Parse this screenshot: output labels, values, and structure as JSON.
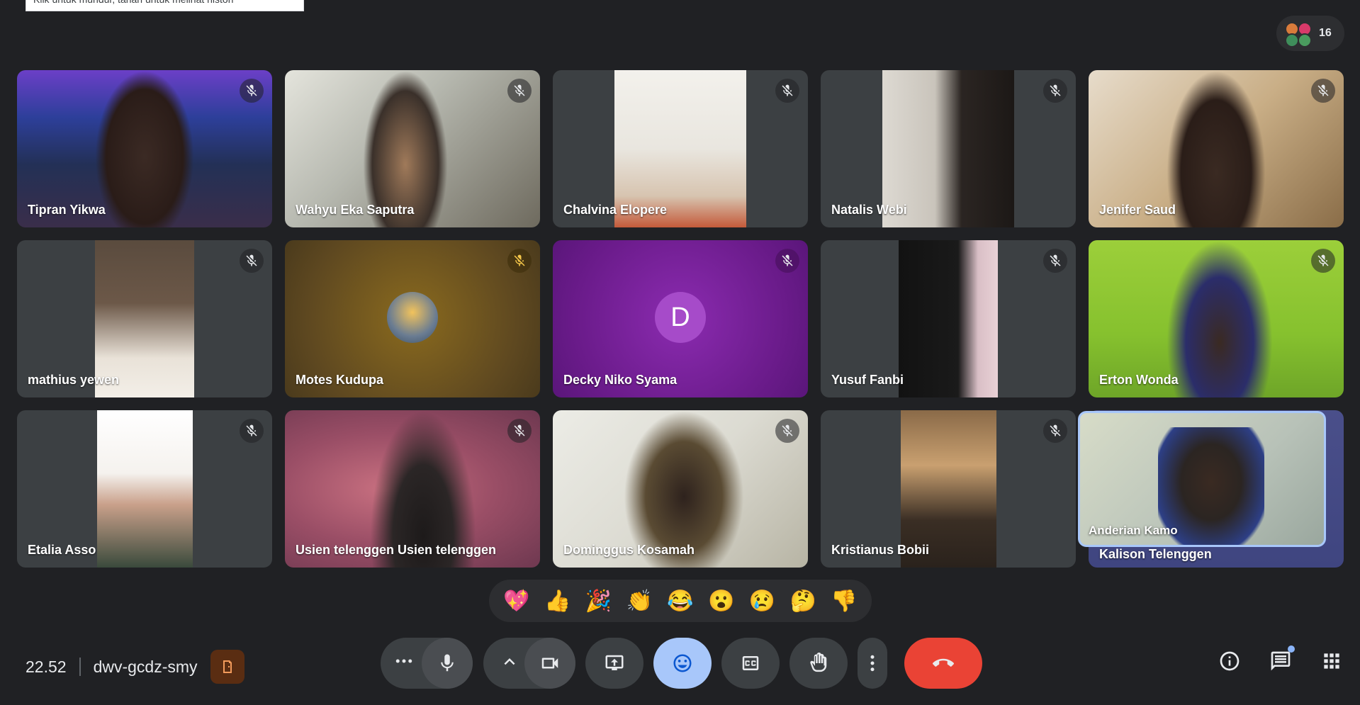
{
  "tooltip": "Klik untuk mundur, tahan untuk melihat histori",
  "people_count": "16",
  "participants": [
    {
      "name": "Tipran Yikwa"
    },
    {
      "name": "Wahyu Eka Saputra"
    },
    {
      "name": "Chalvina Elopere"
    },
    {
      "name": "Natalis Webi"
    },
    {
      "name": "Jenifer Saud"
    },
    {
      "name": "mathius yewen"
    },
    {
      "name": "Motes Kudupa"
    },
    {
      "name": "Decky Niko Syama",
      "initial": "D"
    },
    {
      "name": "Yusuf Fanbi"
    },
    {
      "name": "Erton Wonda"
    },
    {
      "name": "Etalia Asso"
    },
    {
      "name": "Usien telenggen Usien telenggen"
    },
    {
      "name": "Dominggus Kosamah"
    },
    {
      "name": "Kristianus Bobii"
    },
    {
      "name": "Kalison Telenggen"
    }
  ],
  "self_view_name": "Anderian Kamo",
  "reactions": [
    "💖",
    "👍",
    "🎉",
    "👏",
    "😂",
    "😮",
    "😢",
    "🤔",
    "👎"
  ],
  "time": "22.52",
  "meeting_code": "dwv-gcdz-smy",
  "colors": {
    "background": "#202124",
    "end_call": "#ea4335",
    "active_button": "#a8c7fa",
    "decky_tile": "#7b1fa2",
    "motes_tile": "#8a6a1e"
  }
}
